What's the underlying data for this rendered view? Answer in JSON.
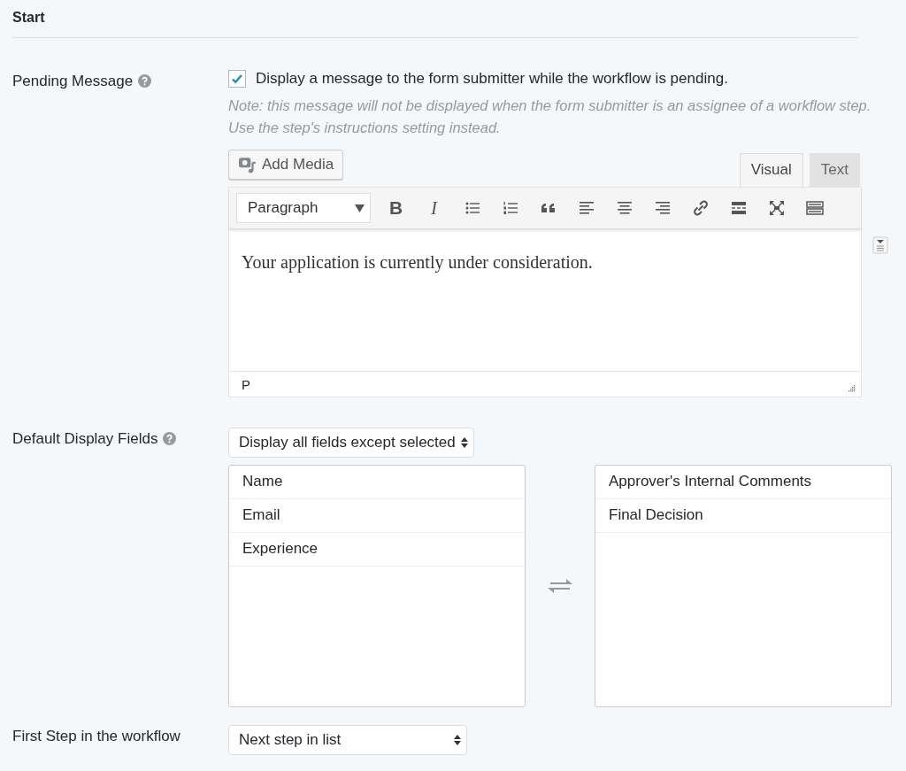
{
  "section": {
    "title": "Start"
  },
  "pending_message": {
    "label": "Pending Message",
    "checkbox": {
      "label": "Display a message to the form submitter while the workflow is pending.",
      "checked": true
    },
    "note": "Note: this message will not be displayed when the form submitter is an assignee of a workflow step. Use the step's instructions setting instead.",
    "add_media": "Add Media",
    "tabs": [
      {
        "label": "Visual",
        "selected": true
      },
      {
        "label": "Text",
        "selected": false
      }
    ],
    "format_select": "Paragraph",
    "toolbar": [
      {
        "kind": "bold",
        "label": "B"
      },
      {
        "kind": "italic",
        "label": "I"
      },
      {
        "kind": "bullets"
      },
      {
        "kind": "numbers"
      },
      {
        "kind": "quote"
      },
      {
        "kind": "align-left"
      },
      {
        "kind": "align-center"
      },
      {
        "kind": "align-right"
      },
      {
        "kind": "link"
      },
      {
        "kind": "more"
      },
      {
        "kind": "fullscreen"
      },
      {
        "kind": "keyboard"
      }
    ],
    "content": "Your application is currently under consideration.",
    "path": "P"
  },
  "display_fields": {
    "label": "Default Display Fields",
    "mode": "Display all fields except selected",
    "available": [
      "Name",
      "Email",
      "Experience"
    ],
    "selected": [
      "Approver's Internal Comments",
      "Final Decision"
    ]
  },
  "first_step": {
    "label": "First Step in the workflow",
    "value": "Next step in list"
  }
}
